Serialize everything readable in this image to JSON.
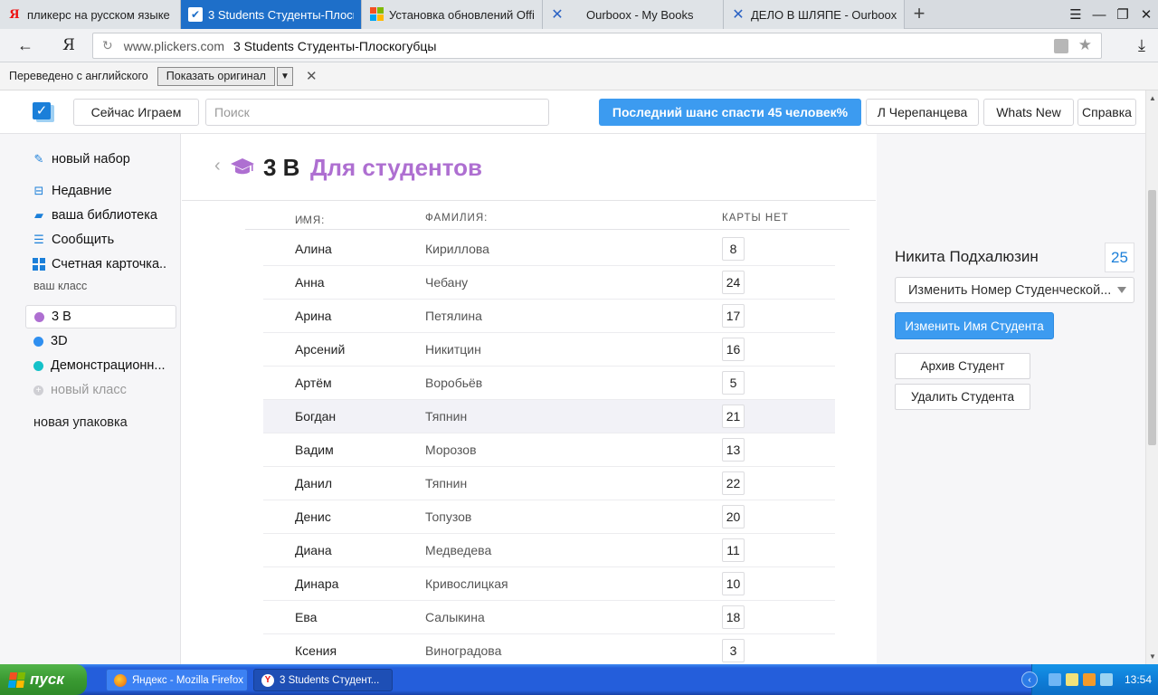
{
  "browser": {
    "tabs": [
      {
        "title": "пликерс на русском языке –",
        "icon": "yandex-icon"
      },
      {
        "title": "3 Students Студенты-Плоскогубцы",
        "icon": "plickers-check-icon",
        "active": true
      },
      {
        "title": "Установка обновлений Office",
        "icon": "microsoft-icon"
      },
      {
        "title": "Ourboox - My Books",
        "icon": "ourboox-icon"
      },
      {
        "title": "ДЕЛО В ШЛЯПЕ - Ourboox",
        "icon": "ourboox-icon"
      }
    ],
    "url_domain": "www.plickers.com",
    "url_title": "3 Students Студенты-Плоскогубцы"
  },
  "translate_bar": {
    "message": "Переведено с английского",
    "show_original": "Показать оригинал"
  },
  "header": {
    "now_playing": "Сейчас Играем",
    "search_placeholder": "Поиск",
    "promo": "Последний шанс спасти 45 человек%",
    "user": "Л Черепанцева",
    "whats_new": "Whats New",
    "help": "Справка"
  },
  "sidebar": {
    "new_set": "новый набор",
    "recent": "Недавние",
    "library": "ваша библиотека",
    "report": "Сообщить",
    "scoresheet": "Счетная карточка..",
    "your_classes": "ваш класс",
    "classes": [
      {
        "name": "3 В",
        "color": "#ae6fd1",
        "active": true
      },
      {
        "name": "3D",
        "color": "#2f8ff0"
      },
      {
        "name": "Демонстрационн...",
        "color": "#14c1c9"
      }
    ],
    "new_class": "новый класс",
    "new_pack": "новая упаковка"
  },
  "main": {
    "title": "3 В",
    "subtitle": "Для студентов",
    "columns": {
      "first": "ИМЯ:",
      "last": "ФАМИЛИЯ:",
      "card": "КАРТЫ НЕТ"
    },
    "students": [
      {
        "first": "Алина",
        "last": "Кириллова",
        "card": "8"
      },
      {
        "first": "Анна",
        "last": "Чебану",
        "card": "24"
      },
      {
        "first": "Арина",
        "last": "Петялина",
        "card": "17"
      },
      {
        "first": "Арсений",
        "last": "Никитцин",
        "card": "16"
      },
      {
        "first": "Артём",
        "last": "Воробьёв",
        "card": "5"
      },
      {
        "first": "Богдан",
        "last": "Тяпнин",
        "card": "21",
        "selected": true
      },
      {
        "first": "Вадим",
        "last": "Морозов",
        "card": "13"
      },
      {
        "first": "Данил",
        "last": "Тяпнин",
        "card": "22"
      },
      {
        "first": "Денис",
        "last": "Топузов",
        "card": "20"
      },
      {
        "first": "Диана",
        "last": "Медведева",
        "card": "11"
      },
      {
        "first": "Динара",
        "last": "Кривослицкая",
        "card": "10"
      },
      {
        "first": "Ева",
        "last": "Салыкина",
        "card": "18"
      },
      {
        "first": "Ксения",
        "last": "Виноградова",
        "card": "3"
      }
    ]
  },
  "panel": {
    "student_name": "Никита Подхалюзин",
    "card_number": "25",
    "change_card": "Изменить Номер Студенческой...",
    "rename": "Изменить Имя Студента",
    "archive": "Архив Студент",
    "delete": "Удалить Студента"
  },
  "taskbar": {
    "start": "пуск",
    "tasks": [
      "Яндекс - Mozilla Firefox",
      "3 Students Студент..."
    ],
    "clock": "13:54"
  },
  "colors": {
    "accent": "#3c9bf0",
    "brand_blue": "#1b7fd9",
    "purple": "#ae6fd1"
  }
}
